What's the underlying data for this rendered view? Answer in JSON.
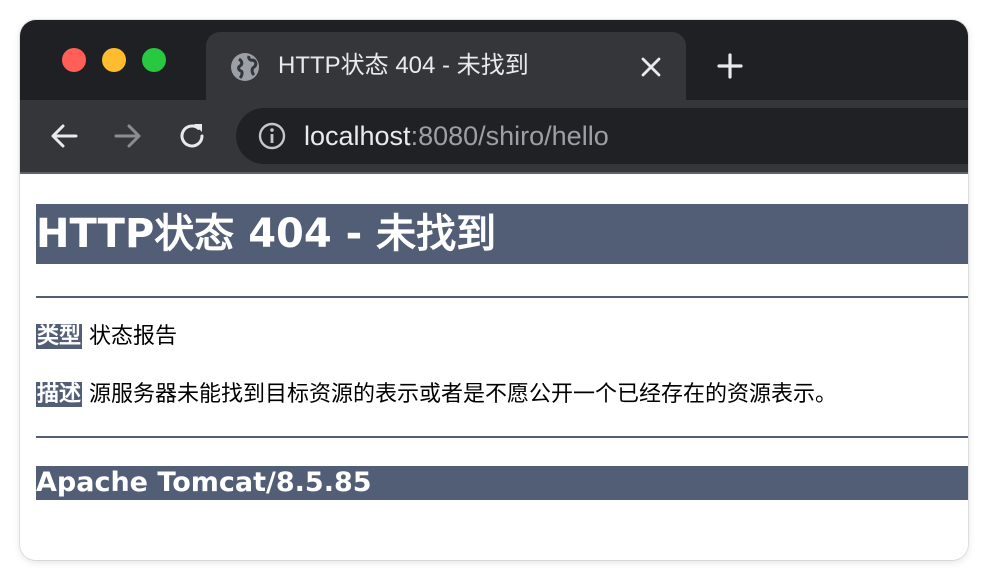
{
  "browser": {
    "tab": {
      "title": "HTTP状态 404 - 未找到",
      "icon": "globe-icon",
      "close_icon": "close-icon"
    },
    "new_tab_icon": "plus-icon",
    "nav": {
      "back_icon": "arrow-left-icon",
      "forward_icon": "arrow-right-icon",
      "reload_icon": "reload-icon"
    },
    "address": {
      "info_icon": "info-icon",
      "host": "localhost",
      "path": ":8080/shiro/hello"
    },
    "colors": {
      "tabstrip": "#1f2023",
      "toolbar": "#35363a",
      "omnibox": "#202124",
      "traffic_red": "#ff5f57",
      "traffic_yellow": "#febc2e",
      "traffic_green": "#28c840"
    }
  },
  "page": {
    "heading": "HTTP状态 404 - 未找到",
    "type_label": "类型",
    "type_value": "状态报告",
    "description_label": "描述",
    "description_value": "源服务器未能找到目标资源的表示或者是不愿公开一个已经存在的资源表示。",
    "footer": "Apache Tomcat/8.5.85",
    "colors": {
      "banner": "#525d76",
      "banner_text": "#ffffff"
    }
  }
}
